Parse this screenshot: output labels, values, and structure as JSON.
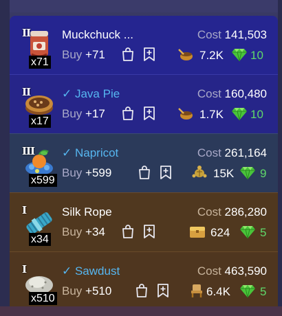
{
  "labels": {
    "cost": "Cost",
    "buy": "Buy"
  },
  "items": [
    {
      "tier": "II",
      "qty": "x71",
      "name": "Muckchuck ...",
      "checked": false,
      "cost": "141,503",
      "buy": "+71",
      "resource": "7.2K",
      "resource_icon": "pot-icon",
      "gems": "10",
      "theme": "blue"
    },
    {
      "tier": "II",
      "qty": "x17",
      "name": "✓ Java Pie",
      "checked": true,
      "cost": "160,480",
      "buy": "+17",
      "resource": "1.7K",
      "resource_icon": "pot-icon",
      "gems": "10",
      "theme": "blue"
    },
    {
      "tier": "III",
      "qty": "x599",
      "name": "✓ Napricot",
      "checked": true,
      "cost": "261,164",
      "buy": "+599",
      "resource": "15K",
      "resource_icon": "turtle-icon",
      "gems": "9",
      "theme": "slate"
    },
    {
      "tier": "I",
      "qty": "x34",
      "name": "Silk Rope",
      "checked": false,
      "cost": "286,280",
      "buy": "+34",
      "resource": "624",
      "resource_icon": "chest-icon",
      "gems": "5",
      "theme": "brown"
    },
    {
      "tier": "I",
      "qty": "x510",
      "name": "✓ Sawdust",
      "checked": true,
      "cost": "463,590",
      "buy": "+510",
      "resource": "6.4K",
      "resource_icon": "chair-icon",
      "gems": "5",
      "theme": "brown"
    }
  ],
  "colors": {
    "checked_name": "#56b6f0",
    "gem_value": "#5fd86a"
  }
}
